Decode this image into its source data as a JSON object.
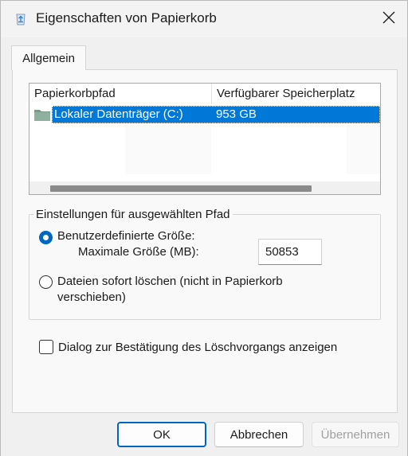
{
  "window": {
    "title": "Eigenschaften von Papierkorb",
    "app_icon": "recycle-bin-icon",
    "close_icon": "close-icon"
  },
  "tabs": [
    {
      "label": "Allgemein",
      "selected": true
    }
  ],
  "location_list": {
    "columns": [
      "Papierkorbpfad",
      "Verfügbarer Speicherplatz"
    ],
    "rows": [
      {
        "path": "Lokaler Datenträger (C:)",
        "free_space": "953 GB",
        "icon": "drive-folder-icon",
        "selected": true
      }
    ]
  },
  "settings_group": {
    "title": "Einstellungen für ausgewählten Pfad",
    "custom_size": {
      "label": "Benutzerdefinierte Größe:",
      "checked": true,
      "max_size_label": "Maximale Größe (MB):",
      "max_size_value": "50853"
    },
    "delete_immediately": {
      "label_line1": "Dateien sofort löschen (nicht in Papierkorb",
      "label_line2": "verschieben)",
      "checked": false
    }
  },
  "confirm_dialog": {
    "label": "Dialog zur Bestätigung des Löschvorgangs anzeigen",
    "checked": false
  },
  "buttons": {
    "ok": "OK",
    "cancel": "Abbrechen",
    "apply": "Übernehmen"
  },
  "colors": {
    "accent": "#0078d7",
    "selection_text": "#ffffff"
  }
}
